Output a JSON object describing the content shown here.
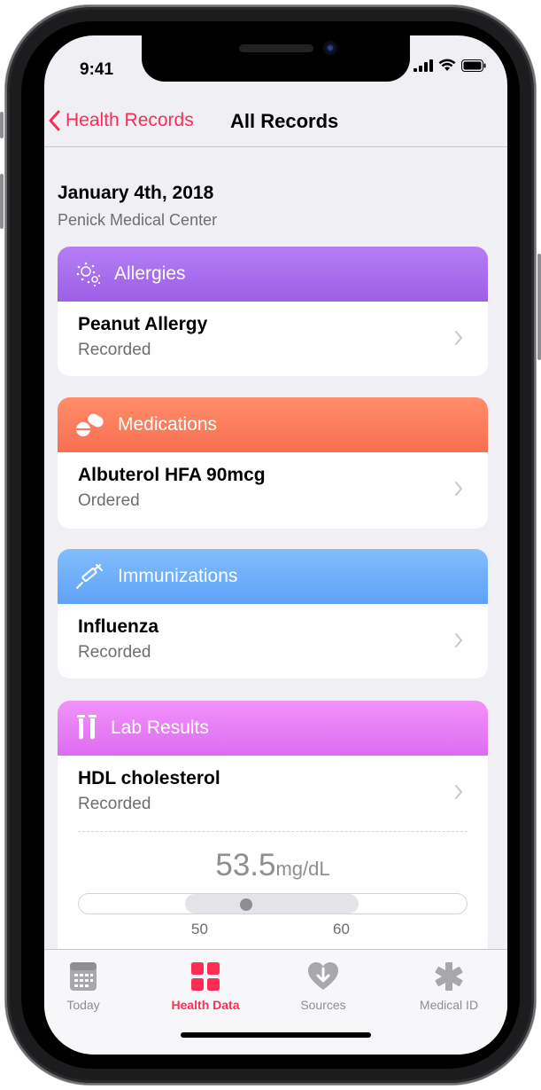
{
  "status_bar": {
    "time": "9:41"
  },
  "navbar": {
    "back_label": "Health Records",
    "title": "All Records"
  },
  "record": {
    "date": "January 4th, 2018",
    "source": "Penick Medical Center"
  },
  "cards": {
    "allergies": {
      "title": "Allergies",
      "icon": "allergen-icon",
      "item": "Peanut Allergy",
      "status": "Recorded",
      "color": "#a76cf0"
    },
    "medications": {
      "title": "Medications",
      "icon": "pills-icon",
      "item": "Albuterol HFA 90mcg",
      "status": "Ordered",
      "color": "#fb7a5c"
    },
    "immunizations": {
      "title": "Immunizations",
      "icon": "syringe-icon",
      "item": "Influenza",
      "status": "Recorded",
      "color": "#6eb0fa"
    },
    "lab_results": {
      "title": "Lab Results",
      "icon": "test-tubes-icon",
      "item": "HDL cholesterol",
      "status": "Recorded",
      "color": "#e87ef6",
      "value": "53.5",
      "unit": "mg/dL",
      "range": {
        "low": "50",
        "high": "60",
        "value_fraction": 0.35
      }
    }
  },
  "tabbar": {
    "tabs": [
      {
        "label": "Today",
        "icon": "calendar-icon",
        "active": false
      },
      {
        "label": "Health Data",
        "icon": "grid-icon",
        "active": true
      },
      {
        "label": "Sources",
        "icon": "heart-download-icon",
        "active": false
      },
      {
        "label": "Medical ID",
        "icon": "asterisk-icon",
        "active": false
      }
    ]
  },
  "colors": {
    "accent": "#ff2d55",
    "background": "#efeff4"
  }
}
